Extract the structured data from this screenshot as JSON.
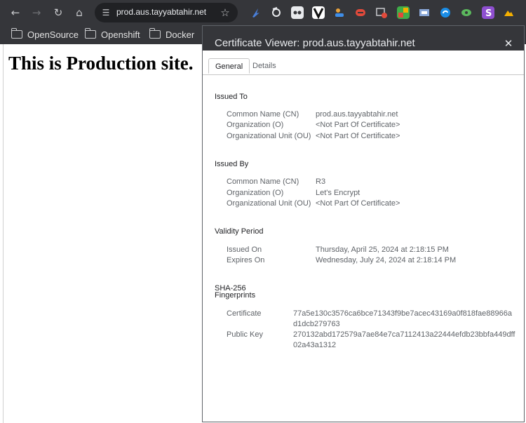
{
  "browser": {
    "url": "prod.aus.tayyabtahir.net",
    "nav_icons": {
      "back": "back-arrow-icon",
      "forward": "forward-arrow-icon",
      "reload": "reload-icon",
      "home": "home-icon"
    },
    "extension_colors": [
      "#4a7fd8",
      "#e8eaed",
      "#e8eaed",
      "#ffffff",
      "#e8a23c",
      "#e24a3b",
      "#c8c9cc",
      "#3fae48",
      "#8aa8d8",
      "#1a8de6",
      "#5bb85d",
      "#8e4fd0",
      "#f5b000"
    ]
  },
  "bookmarks": [
    {
      "label": "OpenSource"
    },
    {
      "label": "Openshift"
    },
    {
      "label": "Docker"
    }
  ],
  "page": {
    "heading": "This is Production site."
  },
  "dialog": {
    "title": "Certificate Viewer: prod.aus.tayyabtahir.net",
    "tabs": [
      "General",
      "Details"
    ],
    "issued_to": {
      "title": "Issued To",
      "rows": [
        {
          "key": "Common Name (CN)",
          "value": "prod.aus.tayyabtahir.net"
        },
        {
          "key": "Organization (O)",
          "value": "<Not Part Of Certificate>"
        },
        {
          "key": "Organizational Unit (OU)",
          "value": "<Not Part Of Certificate>"
        }
      ]
    },
    "issued_by": {
      "title": "Issued By",
      "rows": [
        {
          "key": "Common Name (CN)",
          "value": "R3"
        },
        {
          "key": "Organization (O)",
          "value": "Let's Encrypt"
        },
        {
          "key": "Organizational Unit (OU)",
          "value": "<Not Part Of Certificate>"
        }
      ]
    },
    "validity": {
      "title": "Validity Period",
      "rows": [
        {
          "key": "Issued On",
          "value": "Thursday, April 25, 2024 at 2:18:15 PM"
        },
        {
          "key": "Expires On",
          "value": "Wednesday, July 24, 2024 at 2:18:14 PM"
        }
      ]
    },
    "fingerprints": {
      "title_line1": "SHA-256",
      "title_line2": "Fingerprints",
      "rows": [
        {
          "key": "Certificate",
          "value": "77a5e130c3576ca6bce71343f9be7acec43169a0f818fae88966ad1dcb279763"
        },
        {
          "key": "Public Key",
          "value": "270132abd172579a7ae84e7ca7112413a22444efdb23bbfa449dff02a43a1312"
        }
      ]
    }
  }
}
